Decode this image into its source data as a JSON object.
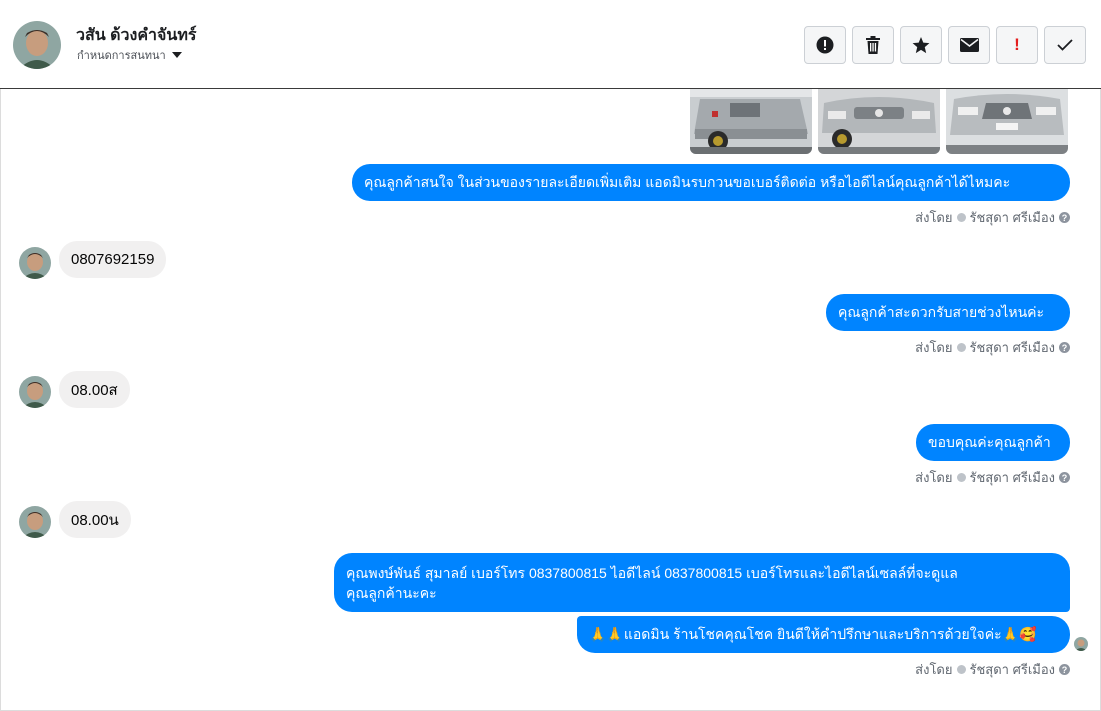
{
  "header": {
    "contact_name": "วสัน ด้วงคำจันทร์",
    "subtitle": "กำหนดการสนทนา",
    "icons": [
      "alert-circle-icon",
      "trash-icon",
      "star-icon",
      "envelope-icon",
      "exclamation-icon",
      "check-icon"
    ],
    "exclamation_text": "!"
  },
  "colors": {
    "outgoing": "#0084ff",
    "incoming": "#f1f0f0",
    "accent_red": "#e41e1e"
  },
  "messages": {
    "m1": "คุณลูกค้าสนใจ ในส่วนของรายละเอียดเพิ่มเติม แอดมินรบกวนขอเบอร์ติดต่อ หรือไอดีไลน์คุณลูกค้าได้ไหมคะ",
    "m2": "0807692159",
    "m3": "คุณลูกค้าสะดวกรับสายช่วงไหนค่ะ",
    "m4": "08.00ส",
    "m5": "ขอบคุณค่ะคุณลูกค้า",
    "m6": "08.00น",
    "m7_line1": "คุณพงษ์พันธ์ สุมาลย์      เบอร์โทร 0837800815  ไอดีไลน์ 0837800815   เบอร์โทรและไอดีไลน์เซลล์ที่จะดูแล",
    "m7_line2": "คุณลูกค้านะคะ",
    "m8": "🙏🙏แอดมิน ร้านโชคคุณโชค ยินดีให้คำปรึกษาและบริการด้วยใจค่ะ🙏🥰"
  },
  "sent_by": {
    "prefix": "ส่งโดย",
    "agent": "รัชสุดา ศรีเมือง",
    "help": "?"
  }
}
